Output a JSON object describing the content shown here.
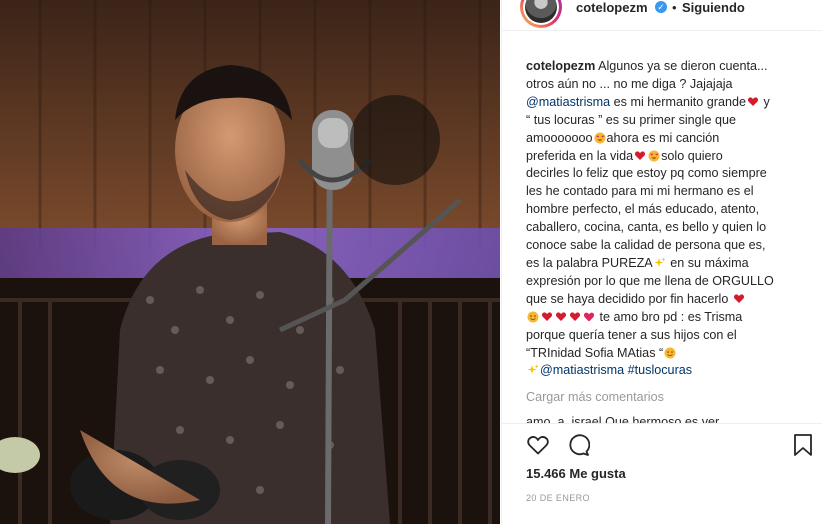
{
  "post": {
    "username": "cotelopezm",
    "separator": "•",
    "following_label": "Siguiendo",
    "caption_lines": [
      [
        "Algunos ya se dieron cuenta..."
      ],
      [
        "otros aún no ... no me diga ? Jajajaja"
      ],
      [
        "@matiastrisma",
        " es mi hermanito grande",
        " y"
      ],
      [
        "“ tus locuras ” es su primer single que"
      ],
      [
        "amooooooo",
        "ahora es mi canción"
      ],
      [
        "preferida en la vida",
        "solo quiero"
      ],
      [
        "decirles lo feliz que estoy pq como siempre"
      ],
      [
        "les he contado para mi mi hermano es el"
      ],
      [
        "hombre perfecto, el más educado, atento,"
      ],
      [
        "caballero, cocina, canta, es bello y quien lo"
      ],
      [
        "conoce sabe la calidad de persona que es,"
      ],
      [
        "es la palabra PUREZA",
        " en su máxima"
      ],
      [
        "expresión por lo que me llena de ORGULLO"
      ],
      [
        "que se haya decidido por fin hacerlo"
      ],
      [
        "te amo bro pd : es Trisma"
      ],
      [
        "porque quería tener a sus hijos con el"
      ],
      [
        "“TRInidad Sofia MAtias “"
      ],
      [
        "@matiastrisma #tuslocuras"
      ]
    ],
    "load_more_label": "Cargar más comentarios",
    "partial_comment": "amo_a_israel Que hermoso es ver",
    "likes": "15.466 Me gusta",
    "date": "20 DE ENERO"
  },
  "icons": {
    "verified": "verified-badge-icon",
    "like": "heart-icon",
    "comment": "comment-bubble-icon",
    "save": "bookmark-icon"
  },
  "colors": {
    "link": "#003569",
    "verified": "#3897f0",
    "muted": "#999999",
    "text": "#262626"
  }
}
